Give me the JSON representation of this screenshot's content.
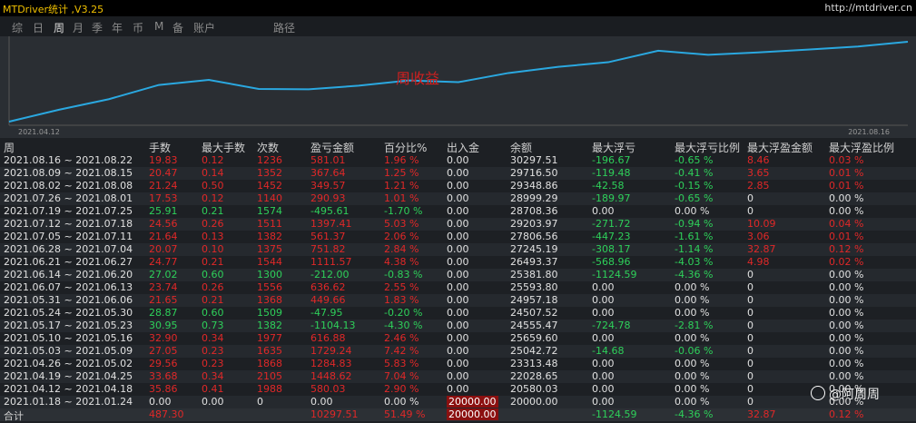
{
  "app": {
    "title": "MTDriver统计 ,V3.25",
    "url": "http://mtdriver.cn"
  },
  "tabs": [
    {
      "label": "综",
      "active": false
    },
    {
      "label": "日",
      "active": false
    },
    {
      "label": "周",
      "active": true
    },
    {
      "label": "月",
      "active": false
    },
    {
      "label": "季",
      "active": false
    },
    {
      "label": "年",
      "active": false
    },
    {
      "label": "币",
      "active": false
    },
    {
      "label": "M",
      "active": false
    },
    {
      "label": "备",
      "active": false
    },
    {
      "label": "账户",
      "active": false
    },
    {
      "label": "路径",
      "active": false
    }
  ],
  "chart": {
    "label": "周收益",
    "x_start": "2021.04.12",
    "x_end": "2021.08.16",
    "line_color": "#2aa8e0",
    "label_color": "#d02020",
    "points": [
      {
        "week": "2021.04.12",
        "balance": 20580.03
      },
      {
        "week": "2021.04.19",
        "balance": 22028.65
      },
      {
        "week": "2021.04.26",
        "balance": 23313.48
      },
      {
        "week": "2021.05.03",
        "balance": 25042.72
      },
      {
        "week": "2021.05.10",
        "balance": 25659.6
      },
      {
        "week": "2021.05.17",
        "balance": 24555.47
      },
      {
        "week": "2021.05.24",
        "balance": 24507.52
      },
      {
        "week": "2021.05.31",
        "balance": 24957.18
      },
      {
        "week": "2021.06.07",
        "balance": 25593.8
      },
      {
        "week": "2021.06.14",
        "balance": 25381.8
      },
      {
        "week": "2021.06.21",
        "balance": 26493.37
      },
      {
        "week": "2021.06.28",
        "balance": 27245.19
      },
      {
        "week": "2021.07.05",
        "balance": 27806.56
      },
      {
        "week": "2021.07.12",
        "balance": 29203.97
      },
      {
        "week": "2021.07.19",
        "balance": 28708.36
      },
      {
        "week": "2021.07.26",
        "balance": 28999.29
      },
      {
        "week": "2021.08.02",
        "balance": 29348.86
      },
      {
        "week": "2021.08.09",
        "balance": 29716.5
      },
      {
        "week": "2021.08.16",
        "balance": 30297.51
      }
    ]
  },
  "columns": [
    "周",
    "手数",
    "最大手数",
    "次数",
    "盈亏金额",
    "百分比%",
    "出入金",
    "余额",
    "最大浮亏",
    "最大浮亏比例",
    "最大浮盈金额",
    "最大浮盈比例"
  ],
  "rows": [
    {
      "week": "2021.08.16 ~ 2021.08.22",
      "lots": "19.83",
      "maxlots": "0.12",
      "count": "1236",
      "pnl": "581.01",
      "pct": "1.96 %",
      "dep": "0.00",
      "bal": "30297.51",
      "maxdd": "-196.67",
      "maxddpct": "-0.65 %",
      "maxfp": "8.46",
      "maxfppct": "0.03 %",
      "sign": "pos"
    },
    {
      "week": "2021.08.09 ~ 2021.08.15",
      "lots": "20.47",
      "maxlots": "0.14",
      "count": "1352",
      "pnl": "367.64",
      "pct": "1.25 %",
      "dep": "0.00",
      "bal": "29716.50",
      "maxdd": "-119.48",
      "maxddpct": "-0.41 %",
      "maxfp": "3.65",
      "maxfppct": "0.01 %",
      "sign": "pos"
    },
    {
      "week": "2021.08.02 ~ 2021.08.08",
      "lots": "21.24",
      "maxlots": "0.50",
      "count": "1452",
      "pnl": "349.57",
      "pct": "1.21 %",
      "dep": "0.00",
      "bal": "29348.86",
      "maxdd": "-42.58",
      "maxddpct": "-0.15 %",
      "maxfp": "2.85",
      "maxfppct": "0.01 %",
      "sign": "pos"
    },
    {
      "week": "2021.07.26 ~ 2021.08.01",
      "lots": "17.53",
      "maxlots": "0.12",
      "count": "1140",
      "pnl": "290.93",
      "pct": "1.01 %",
      "dep": "0.00",
      "bal": "28999.29",
      "maxdd": "-189.97",
      "maxddpct": "-0.65 %",
      "maxfp": "0",
      "maxfppct": "0.00 %",
      "sign": "pos"
    },
    {
      "week": "2021.07.19 ~ 2021.07.25",
      "lots": "25.91",
      "maxlots": "0.21",
      "count": "1574",
      "pnl": "-495.61",
      "pct": "-1.70 %",
      "dep": "0.00",
      "bal": "28708.36",
      "maxdd": "0.00",
      "maxddpct": "0.00 %",
      "maxfp": "0",
      "maxfppct": "0.00 %",
      "sign": "neg"
    },
    {
      "week": "2021.07.12 ~ 2021.07.18",
      "lots": "24.56",
      "maxlots": "0.26",
      "count": "1511",
      "pnl": "1397.41",
      "pct": "5.03 %",
      "dep": "0.00",
      "bal": "29203.97",
      "maxdd": "-271.72",
      "maxddpct": "-0.94 %",
      "maxfp": "10.09",
      "maxfppct": "0.04 %",
      "sign": "pos"
    },
    {
      "week": "2021.07.05 ~ 2021.07.11",
      "lots": "21.64",
      "maxlots": "0.13",
      "count": "1382",
      "pnl": "561.37",
      "pct": "2.06 %",
      "dep": "0.00",
      "bal": "27806.56",
      "maxdd": "-447.23",
      "maxddpct": "-1.61 %",
      "maxfp": "3.06",
      "maxfppct": "0.01 %",
      "sign": "pos"
    },
    {
      "week": "2021.06.28 ~ 2021.07.04",
      "lots": "20.07",
      "maxlots": "0.10",
      "count": "1375",
      "pnl": "751.82",
      "pct": "2.84 %",
      "dep": "0.00",
      "bal": "27245.19",
      "maxdd": "-308.17",
      "maxddpct": "-1.14 %",
      "maxfp": "32.87",
      "maxfppct": "0.12 %",
      "sign": "pos"
    },
    {
      "week": "2021.06.21 ~ 2021.06.27",
      "lots": "24.77",
      "maxlots": "0.21",
      "count": "1544",
      "pnl": "1111.57",
      "pct": "4.38 %",
      "dep": "0.00",
      "bal": "26493.37",
      "maxdd": "-568.96",
      "maxddpct": "-4.03 %",
      "maxfp": "4.98",
      "maxfppct": "0.02 %",
      "sign": "pos"
    },
    {
      "week": "2021.06.14 ~ 2021.06.20",
      "lots": "27.02",
      "maxlots": "0.60",
      "count": "1300",
      "pnl": "-212.00",
      "pct": "-0.83 %",
      "dep": "0.00",
      "bal": "25381.80",
      "maxdd": "-1124.59",
      "maxddpct": "-4.36 %",
      "maxfp": "0",
      "maxfppct": "0.00 %",
      "sign": "neg"
    },
    {
      "week": "2021.06.07 ~ 2021.06.13",
      "lots": "23.74",
      "maxlots": "0.26",
      "count": "1556",
      "pnl": "636.62",
      "pct": "2.55 %",
      "dep": "0.00",
      "bal": "25593.80",
      "maxdd": "0.00",
      "maxddpct": "0.00 %",
      "maxfp": "0",
      "maxfppct": "0.00 %",
      "sign": "pos"
    },
    {
      "week": "2021.05.31 ~ 2021.06.06",
      "lots": "21.65",
      "maxlots": "0.21",
      "count": "1368",
      "pnl": "449.66",
      "pct": "1.83 %",
      "dep": "0.00",
      "bal": "24957.18",
      "maxdd": "0.00",
      "maxddpct": "0.00 %",
      "maxfp": "0",
      "maxfppct": "0.00 %",
      "sign": "pos"
    },
    {
      "week": "2021.05.24 ~ 2021.05.30",
      "lots": "28.87",
      "maxlots": "0.60",
      "count": "1509",
      "pnl": "-47.95",
      "pct": "-0.20 %",
      "dep": "0.00",
      "bal": "24507.52",
      "maxdd": "0.00",
      "maxddpct": "0.00 %",
      "maxfp": "0",
      "maxfppct": "0.00 %",
      "sign": "neg"
    },
    {
      "week": "2021.05.17 ~ 2021.05.23",
      "lots": "30.95",
      "maxlots": "0.73",
      "count": "1382",
      "pnl": "-1104.13",
      "pct": "-4.30 %",
      "dep": "0.00",
      "bal": "24555.47",
      "maxdd": "-724.78",
      "maxddpct": "-2.81 %",
      "maxfp": "0",
      "maxfppct": "0.00 %",
      "sign": "neg"
    },
    {
      "week": "2021.05.10 ~ 2021.05.16",
      "lots": "32.90",
      "maxlots": "0.34",
      "count": "1977",
      "pnl": "616.88",
      "pct": "2.46 %",
      "dep": "0.00",
      "bal": "25659.60",
      "maxdd": "0.00",
      "maxddpct": "0.00 %",
      "maxfp": "0",
      "maxfppct": "0.00 %",
      "sign": "pos"
    },
    {
      "week": "2021.05.03 ~ 2021.05.09",
      "lots": "27.05",
      "maxlots": "0.23",
      "count": "1635",
      "pnl": "1729.24",
      "pct": "7.42 %",
      "dep": "0.00",
      "bal": "25042.72",
      "maxdd": "-14.68",
      "maxddpct": "-0.06 %",
      "maxfp": "0",
      "maxfppct": "0.00 %",
      "sign": "pos"
    },
    {
      "week": "2021.04.26 ~ 2021.05.02",
      "lots": "29.56",
      "maxlots": "0.23",
      "count": "1868",
      "pnl": "1284.83",
      "pct": "5.83 %",
      "dep": "0.00",
      "bal": "23313.48",
      "maxdd": "0.00",
      "maxddpct": "0.00 %",
      "maxfp": "0",
      "maxfppct": "0.00 %",
      "sign": "pos"
    },
    {
      "week": "2021.04.19 ~ 2021.04.25",
      "lots": "33.68",
      "maxlots": "0.34",
      "count": "2105",
      "pnl": "1448.62",
      "pct": "7.04 %",
      "dep": "0.00",
      "bal": "22028.65",
      "maxdd": "0.00",
      "maxddpct": "0.00 %",
      "maxfp": "0",
      "maxfppct": "0.00 %",
      "sign": "pos"
    },
    {
      "week": "2021.04.12 ~ 2021.04.18",
      "lots": "35.86",
      "maxlots": "0.41",
      "count": "1988",
      "pnl": "580.03",
      "pct": "2.90 %",
      "dep": "0.00",
      "bal": "20580.03",
      "maxdd": "0.00",
      "maxddpct": "0.00 %",
      "maxfp": "0",
      "maxfppct": "0.00 %",
      "sign": "pos"
    },
    {
      "week": "2021.01.18 ~ 2021.01.24",
      "lots": "0.00",
      "maxlots": "0.00",
      "count": "0",
      "pnl": "0.00",
      "pct": "0.00 %",
      "dep": "20000.00",
      "bal": "20000.00",
      "maxdd": "0.00",
      "maxddpct": "0.00 %",
      "maxfp": "0",
      "maxfppct": "0.00 %",
      "sign": "neu"
    }
  ],
  "total": {
    "label": "合计",
    "lots": "487.30",
    "pnl": "10297.51",
    "pct": "51.49 %",
    "dep": "20000.00",
    "maxdd": "-1124.59",
    "maxddpct": "-4.36 %",
    "maxfp": "32.87",
    "maxfppct": "0.12 %"
  },
  "watermark": "@阿周周"
}
